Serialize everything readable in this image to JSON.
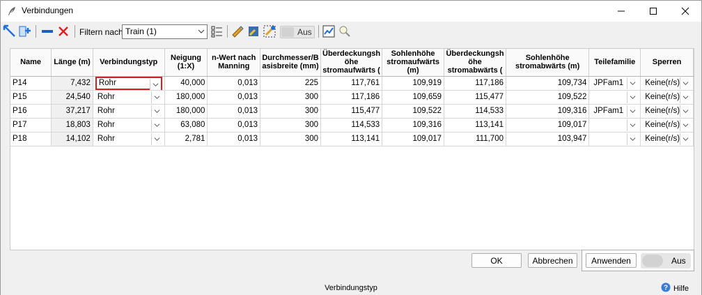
{
  "window": {
    "title": "Verbindungen"
  },
  "toolbar": {
    "filter_label": "Filtern nach",
    "filter_value": "Train (1)",
    "toggle_label": "Aus"
  },
  "grid": {
    "columns": [
      "Name",
      "Länge (m)",
      "Verbindungstyp",
      "Neigung (1:X)",
      "n-Wert nach Manning",
      "Durchmesser/B asisbreite (mm)",
      "Überdeckungsh öhe stromaufwärts (",
      "Sohlenhöhe stromaufwärts (m)",
      "Überdeckungsh öhe stromabwärts (",
      "Sohlenhöhe stromabwärts (m)",
      "Teilefamilie",
      "Sperren"
    ],
    "rows": [
      {
        "name": "P14",
        "laenge": "7,432",
        "typ": "Rohr",
        "neigung": "40,000",
        "nwert": "0,013",
        "durchmesser": "225",
        "ueb_auf": "117,761",
        "sohle_auf": "109,919",
        "ueb_ab": "117,186",
        "sohle_ab": "109,734",
        "familie": "JPFam1",
        "sperren": "Keine(r/s)"
      },
      {
        "name": "P15",
        "laenge": "24,540",
        "typ": "Rohr",
        "neigung": "180,000",
        "nwert": "0,013",
        "durchmesser": "300",
        "ueb_auf": "117,186",
        "sohle_auf": "109,659",
        "ueb_ab": "115,477",
        "sohle_ab": "109,522",
        "familie": "",
        "sperren": "Keine(r/s)"
      },
      {
        "name": "P16",
        "laenge": "37,217",
        "typ": "Rohr",
        "neigung": "180,000",
        "nwert": "0,013",
        "durchmesser": "300",
        "ueb_auf": "115,477",
        "sohle_auf": "109,522",
        "ueb_ab": "114,533",
        "sohle_ab": "109,316",
        "familie": "JPFam1",
        "sperren": "Keine(r/s)"
      },
      {
        "name": "P17",
        "laenge": "18,803",
        "typ": "Rohr",
        "neigung": "63,080",
        "nwert": "0,013",
        "durchmesser": "300",
        "ueb_auf": "114,533",
        "sohle_auf": "109,316",
        "ueb_ab": "113,141",
        "sohle_ab": "109,017",
        "familie": "",
        "sperren": "Keine(r/s)"
      },
      {
        "name": "P18",
        "laenge": "14,102",
        "typ": "Rohr",
        "neigung": "2,781",
        "nwert": "0,013",
        "durchmesser": "300",
        "ueb_auf": "113,141",
        "sohle_auf": "109,017",
        "ueb_ab": "111,700",
        "sohle_ab": "103,947",
        "familie": "",
        "sperren": "Keine(r/s)"
      }
    ]
  },
  "buttons": {
    "ok": "OK",
    "cancel": "Abbrechen",
    "apply": "Anwenden",
    "apply_toggle": "Aus"
  },
  "status": {
    "text": "Verbindungstyp",
    "help": "Hilfe"
  },
  "icons": [
    "feather-icon",
    "minimize-icon",
    "maximize-icon",
    "close-icon",
    "select-connection-icon",
    "add-connection-icon",
    "remove-icon",
    "delete-icon",
    "filter-checklist-icon",
    "edit-icon",
    "properties-icon",
    "zoom-icon",
    "chart-icon",
    "search-icon",
    "help-icon"
  ],
  "colors": {
    "active_border": "#d32020",
    "accent_blue": "#1e6fd9",
    "delete_red": "#e02020"
  }
}
